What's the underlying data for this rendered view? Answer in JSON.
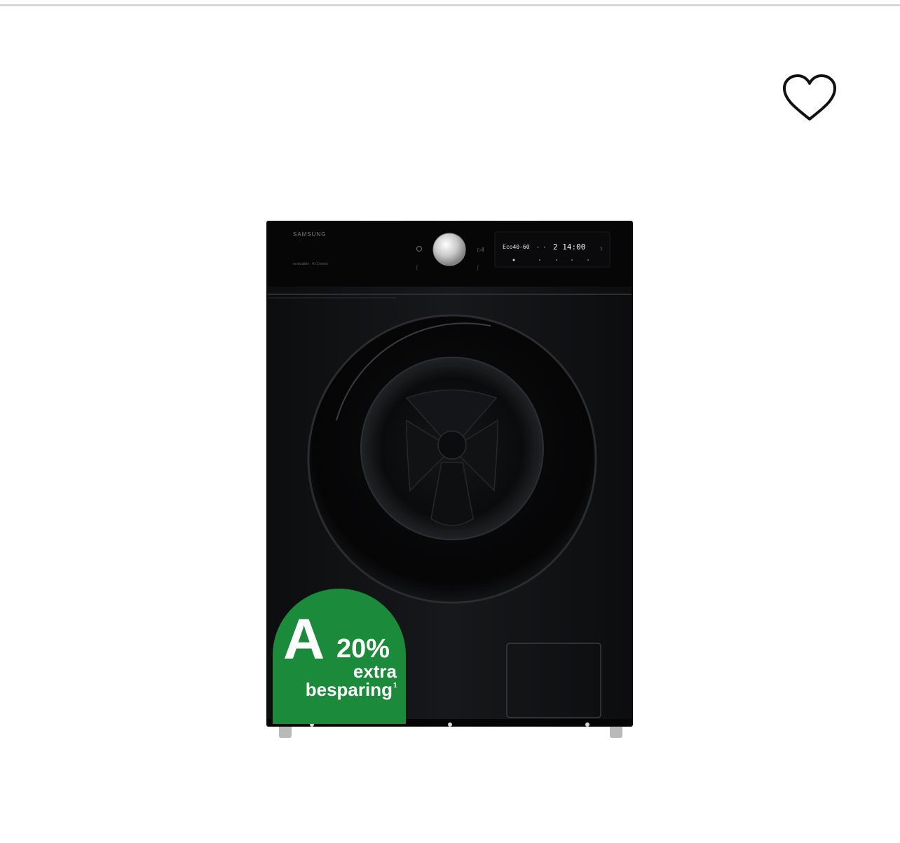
{
  "favorite": {
    "icon": "heart-outline-icon"
  },
  "product": {
    "brand": "SAMSUNG",
    "panel": {
      "program_display": "Eco40-60",
      "time_display": "2 14:00",
      "dash_display": "- -",
      "left_marking": "ecobubble · AI Control"
    },
    "energy_badge": {
      "grade": "A",
      "percent": "20%",
      "line1": "extra",
      "line2": "besparing",
      "footnote": "1",
      "color": "#1b8a3a"
    },
    "body_color": "#111214"
  }
}
